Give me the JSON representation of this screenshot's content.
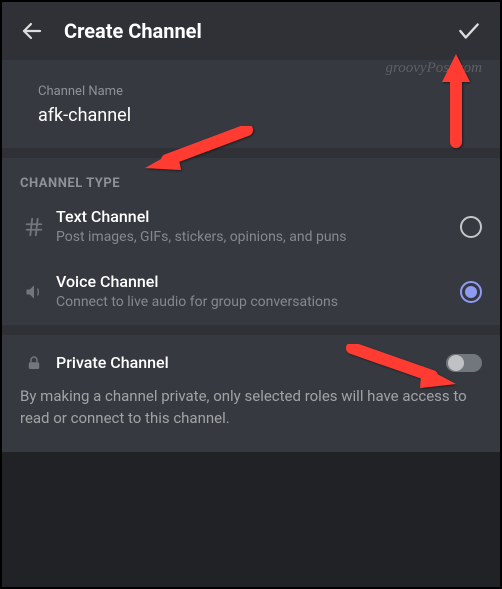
{
  "header": {
    "title": "Create Channel"
  },
  "watermark": "groovyPost.com",
  "channelName": {
    "label": "Channel Name",
    "value": "afk-channel"
  },
  "channelType": {
    "heading": "CHANNEL TYPE",
    "options": [
      {
        "title": "Text Channel",
        "description": "Post images, GIFs, stickers, opinions, and puns",
        "selected": false
      },
      {
        "title": "Voice Channel",
        "description": "Connect to live audio for group conversations",
        "selected": true
      }
    ]
  },
  "private": {
    "title": "Private Channel",
    "enabled": false,
    "description": "By making a channel private, only selected roles will have access to read or connect to this channel."
  }
}
